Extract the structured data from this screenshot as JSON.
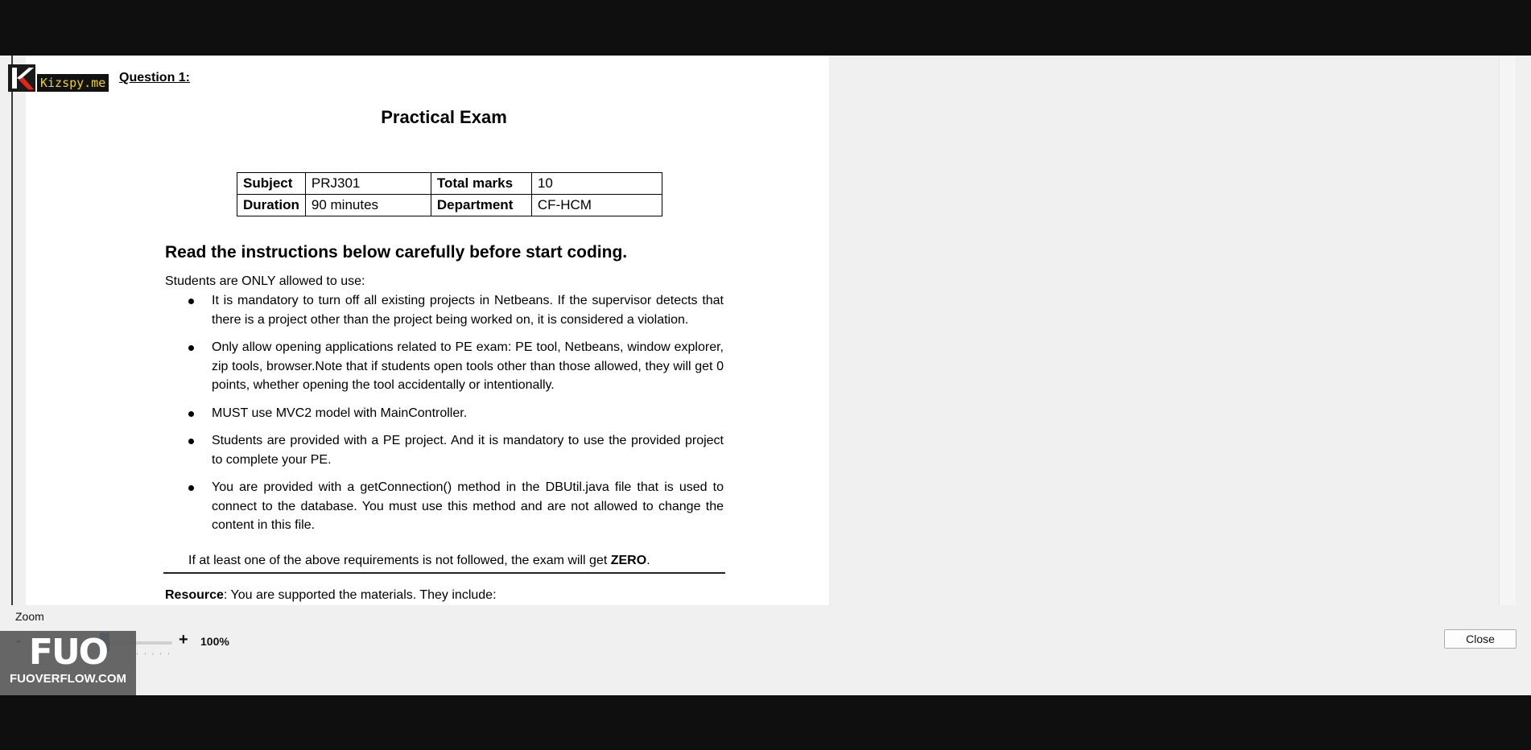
{
  "document": {
    "logo_text": "Kizspy.me",
    "question_label": "Question 1:",
    "title": "Practical Exam",
    "info_table": {
      "rows": [
        [
          "Subject",
          "PRJ301",
          "Total marks",
          "10"
        ],
        [
          "Duration",
          "90 minutes",
          "Department",
          "CF-HCM"
        ]
      ]
    },
    "heading": "Read the instructions below carefully before start coding.",
    "intro": "Students are ONLY allowed to use:",
    "rules": [
      "It is mandatory to turn off all existing projects in Netbeans. If the supervisor detects that there is a project other than the project being worked on, it is considered a violation.",
      "Only allow opening applications related to PE exam: PE tool, Netbeans, window explorer, zip tools, browser.Note that if students open tools other than those allowed, they will get 0 points, whether opening the tool accidentally or intentionally.",
      "MUST use MVC2 model with MainController.",
      "Students are provided with a PE project. And it is mandatory to use the provided project to complete your PE.",
      "You are provided with a getConnection() method in the DBUtil.java file that is used to connect to the database. You must use this method and are not allowed to change the content in this file."
    ],
    "warning_prefix": "If at least one of the above requirements is not followed, the exam will get ",
    "warning_bold": "ZERO",
    "warning_suffix": ".",
    "resource_bold": "Resource",
    "resource_text": ": You are supported the materials. They include:"
  },
  "zoom": {
    "label": "Zoom",
    "minus": "-",
    "plus": "+",
    "value": "100%",
    "level_percent": 100
  },
  "watermark": {
    "big": "FUO",
    "small": "FUOVERFLOW.COM"
  },
  "buttons": {
    "close": "Close"
  },
  "colors": {
    "accent": "#1f5aa8",
    "logo_text": "#f2d11b"
  }
}
